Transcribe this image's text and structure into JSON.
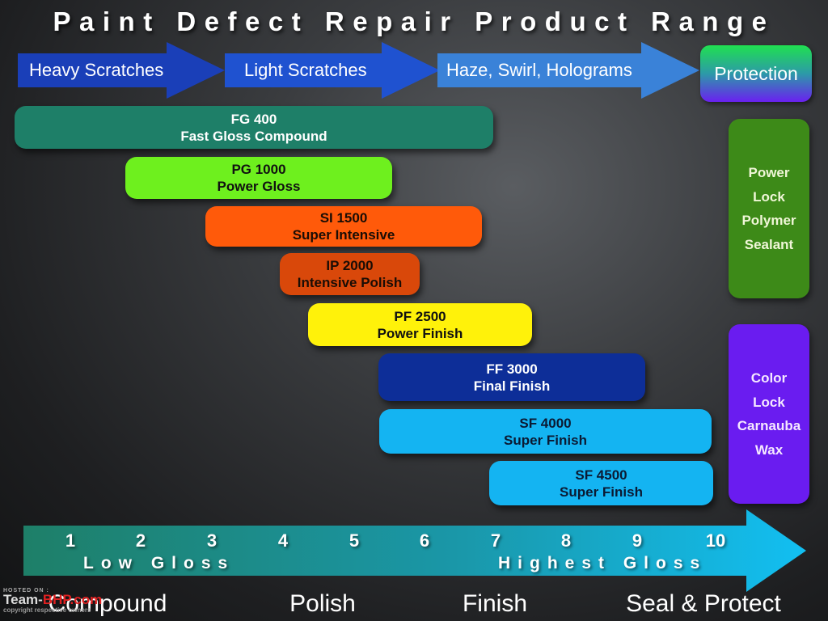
{
  "title": "Paint Defect Repair Product Range",
  "stages_top": [
    {
      "label": "Heavy Scratches",
      "color": "#1a3fb8"
    },
    {
      "label": "Light Scratches",
      "color": "#1f52d0"
    },
    {
      "label": "Haze, Swirl, Holograms",
      "color": "#3a82d8"
    }
  ],
  "protection_label": "Protection",
  "products": [
    {
      "code": "FG 400",
      "name": "Fast Gloss Compound",
      "bg": "#1e7f68",
      "fg": "#ffffff"
    },
    {
      "code": "PG 1000",
      "name": "Power Gloss",
      "bg": "#6ef01e",
      "fg": "#111111"
    },
    {
      "code": "SI 1500",
      "name": "Super Intensive",
      "bg": "#ff5a0a",
      "fg": "#1a0d05"
    },
    {
      "code": "IP 2000",
      "name": "Intensive Polish",
      "bg": "#d9480a",
      "fg": "#1a0d05"
    },
    {
      "code": "PF 2500",
      "name": "Power Finish",
      "bg": "#fff20a",
      "fg": "#111111"
    },
    {
      "code": "FF 3000",
      "name": "Final Finish",
      "bg": "#0d2e98",
      "fg": "#ffffff"
    },
    {
      "code": "SF 4000",
      "name": "Super Finish",
      "bg": "#14b4f2",
      "fg": "#0b1a33"
    },
    {
      "code": "SF 4500",
      "name": "Super Finish",
      "bg": "#14b4f2",
      "fg": "#0b1a33"
    }
  ],
  "protection_products": [
    {
      "lines": [
        "Power",
        "Lock",
        "Polymer",
        "Sealant"
      ],
      "bg": "#3d8a18",
      "fg": "#f0f6d8"
    },
    {
      "lines": [
        "Color",
        "Lock",
        "Carnauba",
        "Wax"
      ],
      "bg": "#6a1cf0",
      "fg": "#f5e8ff"
    }
  ],
  "gloss_scale": {
    "ticks": [
      "1",
      "2",
      "3",
      "4",
      "5",
      "6",
      "7",
      "8",
      "9",
      "10"
    ],
    "low_label": "Low Gloss",
    "high_label": "Highest Gloss"
  },
  "stages_bottom": [
    "Compound",
    "Polish",
    "Finish",
    "Seal & Protect"
  ],
  "watermark": {
    "line1": "HOSTED ON :",
    "brand_a": "Team-",
    "brand_b": "BHP.com",
    "line3": "copyright respective owners"
  }
}
